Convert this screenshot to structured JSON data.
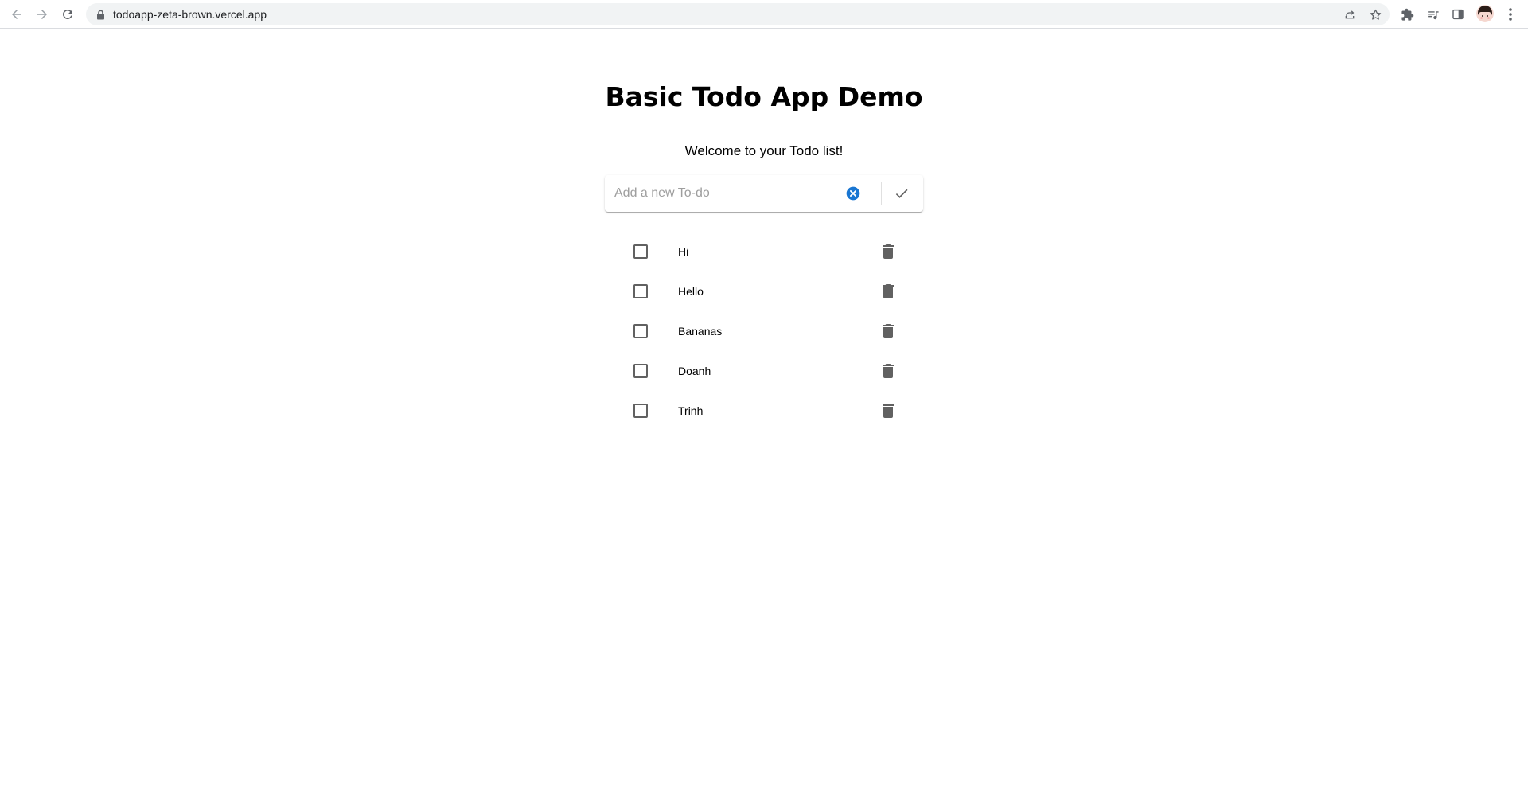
{
  "browser": {
    "url": "todoapp-zeta-brown.vercel.app",
    "icons": {
      "back": "arrow-left",
      "forward": "arrow-right",
      "reload": "reload",
      "lock": "lock",
      "share": "share",
      "bookmark": "star",
      "extensions": "puzzle",
      "media": "media-queue",
      "side_panel": "side-panel",
      "profile": "avatar",
      "menu": "kebab"
    }
  },
  "app": {
    "title": "Basic Todo App Demo",
    "welcome": "Welcome to your Todo list!",
    "input": {
      "value": "",
      "placeholder": "Add a new To-do"
    },
    "accent_color": "#1976d2",
    "icon_color": "#616161"
  },
  "todos": [
    {
      "text": "Hi",
      "done": false
    },
    {
      "text": "Hello",
      "done": false
    },
    {
      "text": "Bananas",
      "done": false
    },
    {
      "text": "Doanh",
      "done": false
    },
    {
      "text": "Trinh",
      "done": false
    }
  ]
}
